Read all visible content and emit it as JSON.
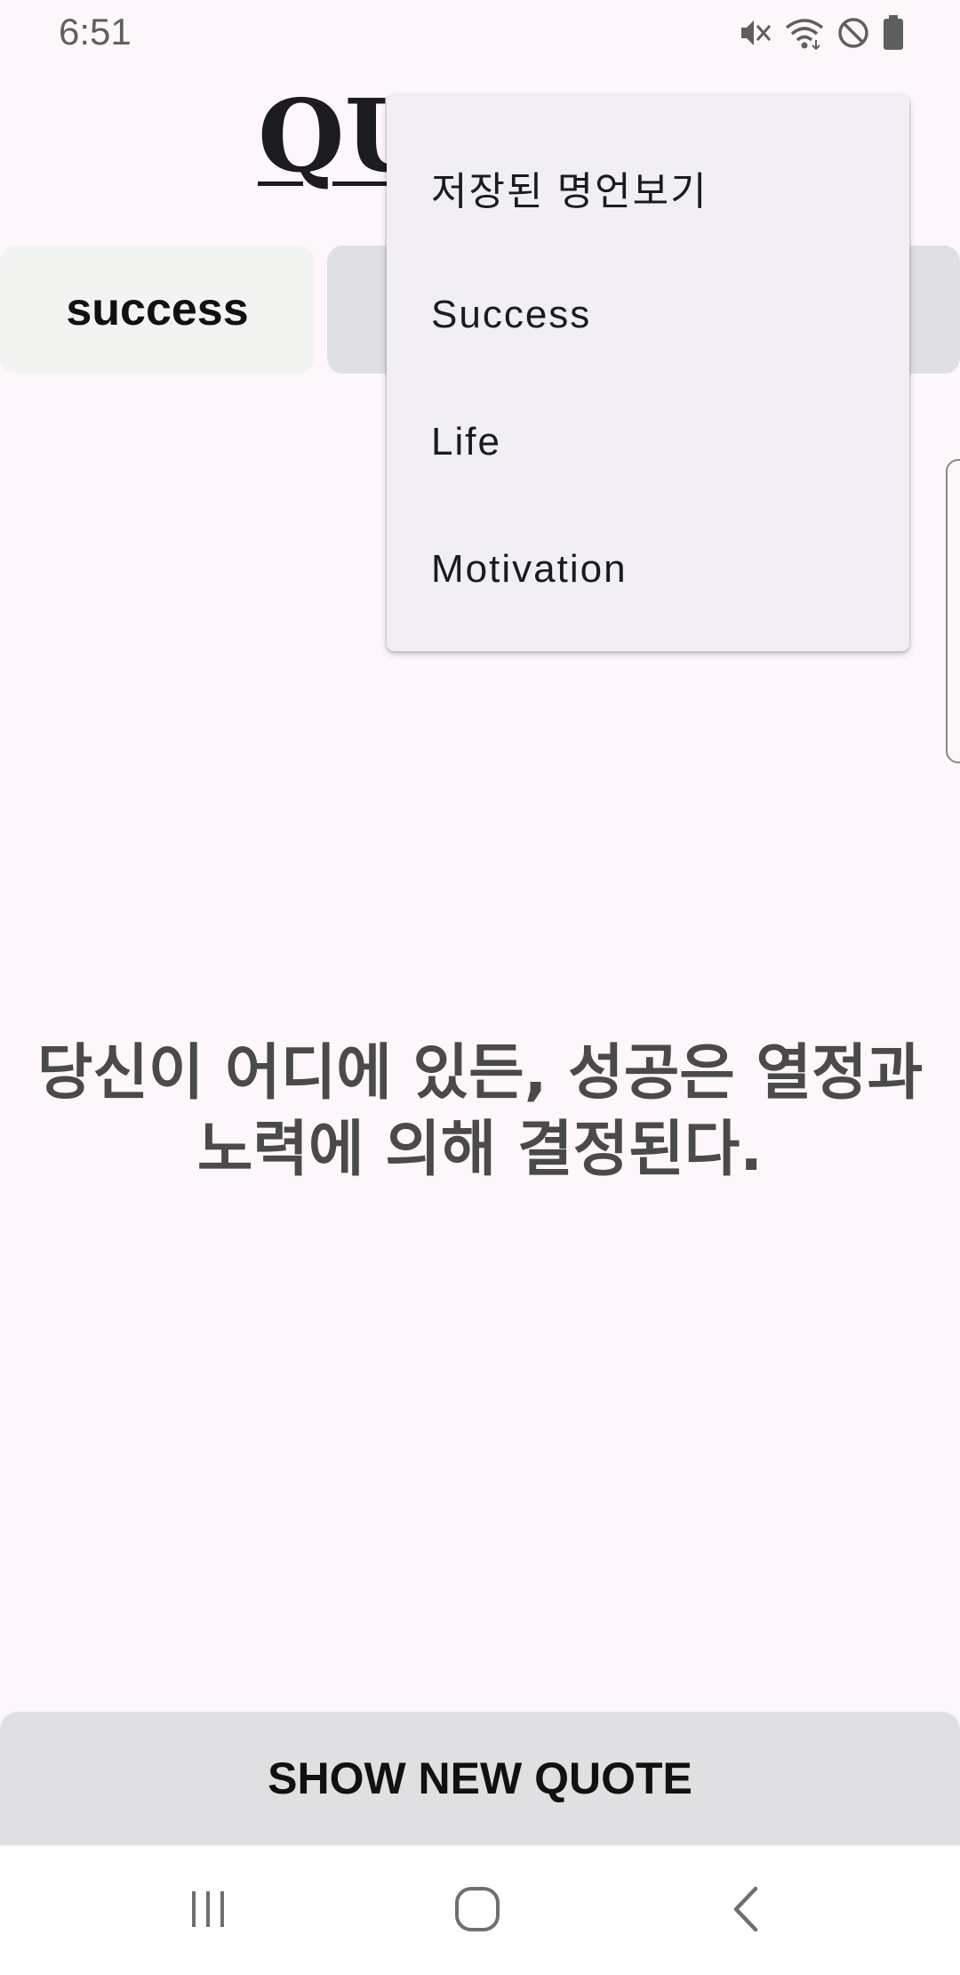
{
  "status_bar": {
    "time": "6:51",
    "icons": [
      "vibrate-mute-icon",
      "wifi-icon",
      "do-not-disturb-icon",
      "battery-icon"
    ]
  },
  "app": {
    "title": "QUOTES"
  },
  "categories": {
    "selected_label": "success"
  },
  "menu": {
    "items": [
      {
        "label": "저장된 명언보기"
      },
      {
        "label": "Success"
      },
      {
        "label": "Life"
      },
      {
        "label": "Motivation"
      }
    ]
  },
  "quote": {
    "line1": "당신이 어디에 있든, 성공은 열정과",
    "line2": "노력에 의해 결정된다."
  },
  "actions": {
    "show_new_quote_label": "SHOW NEW QUOTE"
  },
  "nav_bar": {
    "icons": [
      "recents-icon",
      "home-icon",
      "back-icon"
    ]
  },
  "colors": {
    "background": "#fdf7fc",
    "menu_background": "#f2eef5",
    "button_background": "#e0dfe1",
    "chip_background": "#f3f4f1",
    "quote_text": "#4a4a4a"
  }
}
